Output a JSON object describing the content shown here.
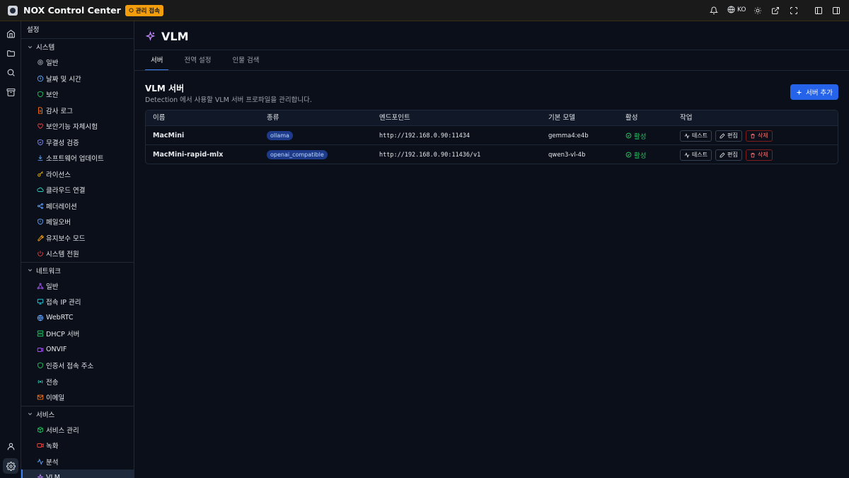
{
  "app": {
    "title": "NOX Control Center",
    "admin_badge": "관리 접속",
    "language": "KO"
  },
  "sidebar": {
    "header": "설정",
    "groups": [
      {
        "label": "시스템",
        "items": [
          {
            "label": "일반",
            "icon": "gear-icon",
            "color": "#9ca3af"
          },
          {
            "label": "날짜 및 시간",
            "icon": "clock-icon",
            "color": "#60a5fa"
          },
          {
            "label": "보안",
            "icon": "shield-icon",
            "color": "#22c55e"
          },
          {
            "label": "감사 로그",
            "icon": "file-icon",
            "color": "#f97316"
          },
          {
            "label": "보안기능 자체시험",
            "icon": "heart-icon",
            "color": "#ef4444"
          },
          {
            "label": "무결성 검증",
            "icon": "shield-check-icon",
            "color": "#818cf8"
          },
          {
            "label": "소프트웨어 업데이트",
            "icon": "download-icon",
            "color": "#60a5fa"
          },
          {
            "label": "라이선스",
            "icon": "key-icon",
            "color": "#eab308"
          },
          {
            "label": "클라우드 연결",
            "icon": "cloud-icon",
            "color": "#2dd4bf"
          },
          {
            "label": "페더레이션",
            "icon": "share-icon",
            "color": "#60a5fa"
          },
          {
            "label": "페일오버",
            "icon": "shield-alert-icon",
            "color": "#60a5fa"
          },
          {
            "label": "유지보수 모드",
            "icon": "wrench-icon",
            "color": "#f59e0b"
          },
          {
            "label": "시스템 전원",
            "icon": "power-icon",
            "color": "#ef4444"
          }
        ]
      },
      {
        "label": "네트워크",
        "items": [
          {
            "label": "일반",
            "icon": "network-icon",
            "color": "#a855f7"
          },
          {
            "label": "접속 IP 관리",
            "icon": "monitor-icon",
            "color": "#22d3ee"
          },
          {
            "label": "WebRTC",
            "icon": "globe-icon",
            "color": "#60a5fa"
          },
          {
            "label": "DHCP 서버",
            "icon": "server-icon",
            "color": "#22c55e"
          },
          {
            "label": "ONVIF",
            "icon": "camera-icon",
            "color": "#a855f7"
          },
          {
            "label": "인증서 접속 주소",
            "icon": "shield-icon",
            "color": "#22c55e"
          },
          {
            "label": "전송",
            "icon": "broadcast-icon",
            "color": "#2dd4bf"
          },
          {
            "label": "이메일",
            "icon": "mail-icon",
            "color": "#f97316"
          }
        ]
      },
      {
        "label": "서비스",
        "items": [
          {
            "label": "서비스 관리",
            "icon": "boxes-icon",
            "color": "#22c55e"
          },
          {
            "label": "녹화",
            "icon": "video-icon",
            "color": "#ef4444"
          },
          {
            "label": "분석",
            "icon": "activity-icon",
            "color": "#60a5fa"
          },
          {
            "label": "VLM",
            "icon": "sparkles-icon",
            "color": "#c084fc",
            "active": true
          }
        ]
      }
    ]
  },
  "page": {
    "title": "VLM",
    "tabs": [
      "서버",
      "전역 설정",
      "인물 검색"
    ],
    "active_tab": 0,
    "section_title": "VLM 서버",
    "section_desc": "Detection 에서 사용할 VLM 서버 프로파일을 관리합니다.",
    "add_button": "서버 추가"
  },
  "table": {
    "columns": [
      "이름",
      "종류",
      "엔드포인트",
      "기본 모델",
      "활성",
      "작업"
    ],
    "rows": [
      {
        "name": "MacMini",
        "type": "ollama",
        "endpoint": "http://192.168.0.90:11434",
        "model": "gemma4:e4b",
        "status": "활성"
      },
      {
        "name": "MacMini-rapid-mlx",
        "type": "openai_compatible",
        "endpoint": "http://192.168.0.90:11436/v1",
        "model": "qwen3-vl-4b",
        "status": "활성"
      }
    ],
    "actions": {
      "test": "테스트",
      "edit": "편집",
      "delete": "삭제"
    }
  }
}
